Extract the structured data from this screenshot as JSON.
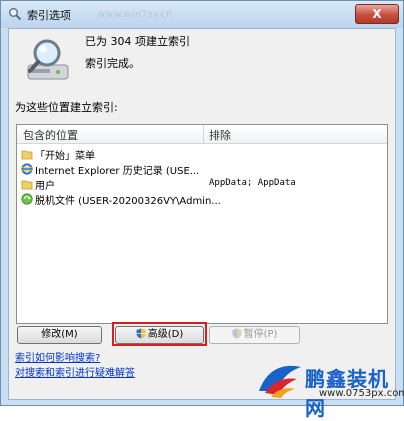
{
  "window": {
    "title": "索引选项",
    "close_label": "X",
    "faint_watermark": "www.win7sy.cn"
  },
  "status": {
    "indexed": "已为 304 项建立索引",
    "complete": "索引完成。"
  },
  "locations": {
    "section_label": "为这些位置建立索引:",
    "headers": {
      "included": "包含的位置",
      "exclude": "排除"
    },
    "rows": [
      {
        "name": "「开始」菜单",
        "exclude": "",
        "icon": "folder-icon"
      },
      {
        "name": "Internet Explorer 历史记录 (USE...",
        "exclude": "",
        "icon": "ie-icon"
      },
      {
        "name": "用户",
        "exclude": "AppData; AppData",
        "icon": "folder-icon"
      },
      {
        "name": "脱机文件 (USER-20200326VY\\Admin...",
        "exclude": "",
        "icon": "offline-files-icon"
      }
    ]
  },
  "buttons": {
    "modify": "修改(M)",
    "advanced": "高级(D)",
    "pause": "暂停(P)"
  },
  "links": {
    "how_affects": "索引如何影响搜索?",
    "troubleshoot": "对搜索和索引进行疑难解答"
  },
  "watermark": {
    "brand": "鹏鑫装机网",
    "site": "www.0753px.com"
  }
}
